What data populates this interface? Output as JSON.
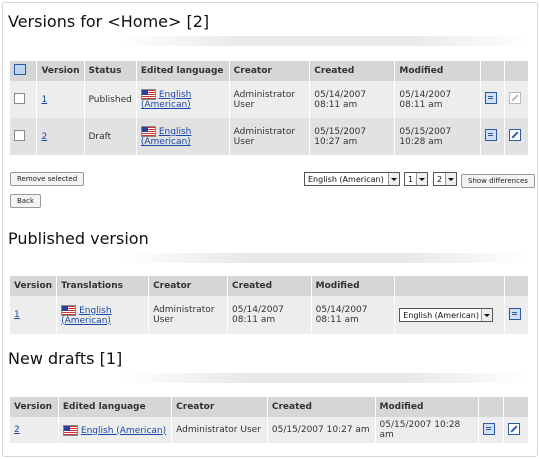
{
  "versions": {
    "title": "Versions for <Home> [2]",
    "headers": [
      "Version",
      "Status",
      "Edited language",
      "Creator",
      "Created",
      "Modified"
    ],
    "rows": [
      {
        "version": "1",
        "status": "Published",
        "language": "English (American)",
        "creator": "Administrator User",
        "created": "05/14/2007 08:11 am",
        "modified": "05/14/2007 08:11 am"
      },
      {
        "version": "2",
        "status": "Draft",
        "language": "English (American)",
        "creator": "Administrator User",
        "created": "05/15/2007 10:27 am",
        "modified": "05/15/2007 10:28 am"
      }
    ],
    "remove_label": "Remove selected",
    "back_label": "Back",
    "lang_select": "English (American)",
    "version_a": "1",
    "version_b": "2",
    "diff_label": "Show differences"
  },
  "published": {
    "title": "Published version",
    "headers": [
      "Version",
      "Translations",
      "Creator",
      "Created",
      "Modified"
    ],
    "row": {
      "version": "1",
      "language": "English (American)",
      "creator": "Administrator User",
      "created": "05/14/2007 08:11 am",
      "modified": "05/14/2007 08:11 am"
    },
    "lang_select": "English (American)"
  },
  "drafts": {
    "title": "New drafts [1]",
    "headers": [
      "Version",
      "Edited language",
      "Creator",
      "Created",
      "Modified"
    ],
    "row": {
      "version": "2",
      "language": "English (American)",
      "creator": "Administrator User",
      "created": "05/15/2007 10:27 am",
      "modified": "05/15/2007 10:28 am"
    }
  }
}
